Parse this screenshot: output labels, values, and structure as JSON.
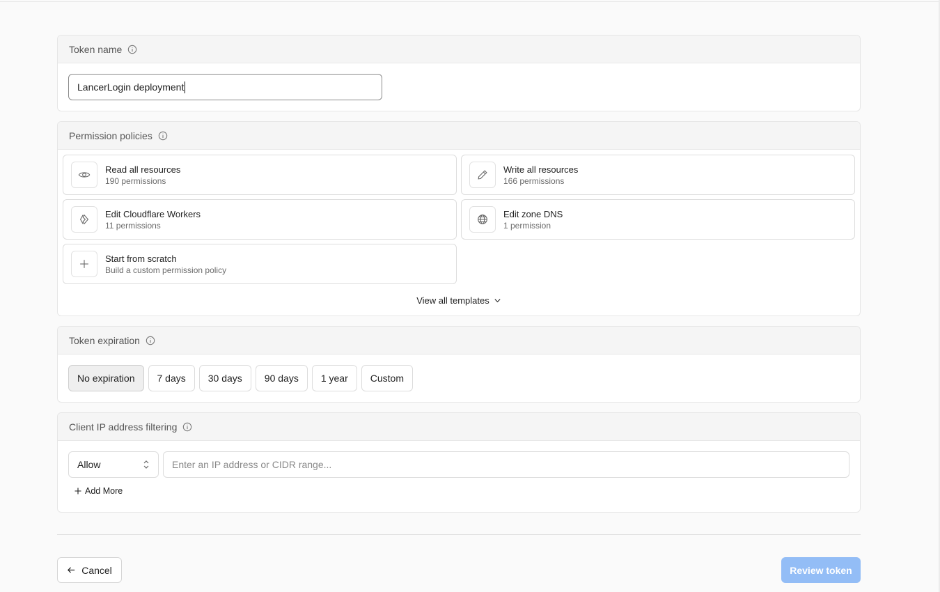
{
  "token_name": {
    "header_label": "Token name",
    "input_value": "LancerLogin deployment"
  },
  "permissions": {
    "header_label": "Permission policies",
    "templates": [
      {
        "title": "Read all resources",
        "subtitle": "190 permissions",
        "icon": "eye-icon"
      },
      {
        "title": "Write all resources",
        "subtitle": "166 permissions",
        "icon": "pencil-icon"
      },
      {
        "title": "Edit Cloudflare Workers",
        "subtitle": "11 permissions",
        "icon": "workers-icon"
      },
      {
        "title": "Edit zone DNS",
        "subtitle": "1 permission",
        "icon": "globe-icon"
      },
      {
        "title": "Start from scratch",
        "subtitle": "Build a custom permission policy",
        "icon": "plus-icon"
      }
    ],
    "view_all_label": "View all templates"
  },
  "expiration": {
    "header_label": "Token expiration",
    "options": [
      "No expiration",
      "7 days",
      "30 days",
      "90 days",
      "1 year",
      "Custom"
    ],
    "selected": "No expiration"
  },
  "ip_filter": {
    "header_label": "Client IP address filtering",
    "mode_value": "Allow",
    "input_placeholder": "Enter an IP address or CIDR range...",
    "add_more_label": "Add More"
  },
  "actions": {
    "cancel_label": "Cancel",
    "review_label": "Review token",
    "review_color": "#93bdf6"
  }
}
